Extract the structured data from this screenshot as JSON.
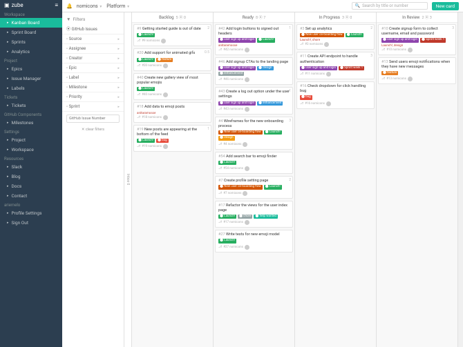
{
  "brand": "zube",
  "topbar": {
    "project": "nomicons",
    "project_suffix": "▼",
    "workspace": "Platform",
    "workspace_suffix": "▼",
    "search_placeholder": "Search by title or number",
    "new_card": "New card"
  },
  "sidebar": {
    "sections": [
      {
        "title": "Workspace",
        "items": [
          {
            "label": "Kanban Board",
            "icon": "board-icon",
            "active": true
          },
          {
            "label": "Sprint Board",
            "icon": "sprint-icon"
          },
          {
            "label": "Sprints",
            "icon": "sprints-icon"
          },
          {
            "label": "Analytics",
            "icon": "analytics-icon"
          }
        ]
      },
      {
        "title": "Project",
        "items": [
          {
            "label": "Epics",
            "icon": "epics-icon"
          },
          {
            "label": "Issue Manager",
            "icon": "issues-icon"
          },
          {
            "label": "Labels",
            "icon": "labels-icon"
          }
        ]
      },
      {
        "title": "Tickets",
        "items": [
          {
            "label": "Tickets",
            "icon": "tickets-icon"
          }
        ]
      },
      {
        "title": "GitHub Components",
        "items": [
          {
            "label": "Milestones",
            "icon": "milestones-icon"
          }
        ]
      },
      {
        "title": "Settings",
        "items": [
          {
            "label": "Project",
            "icon": "settings-project-icon"
          },
          {
            "label": "Workspace",
            "icon": "settings-workspace-icon"
          }
        ]
      },
      {
        "title": "Resources",
        "items": [
          {
            "label": "Slack",
            "icon": "slack-icon"
          },
          {
            "label": "Blog",
            "icon": "blog-icon"
          },
          {
            "label": "Docs",
            "icon": "docs-icon"
          },
          {
            "label": "Contact",
            "icon": "contact-icon"
          }
        ]
      },
      {
        "title": "ariemelo",
        "items": [
          {
            "label": "Profile Settings",
            "icon": "profile-icon"
          },
          {
            "label": "Sign Out",
            "icon": "signout-icon"
          }
        ]
      }
    ]
  },
  "filters": {
    "header": "Filters",
    "rows": [
      {
        "label": "GitHub Issues",
        "icon": "toggle"
      },
      {
        "label": "Source"
      },
      {
        "label": "Assignee"
      },
      {
        "label": "Creator"
      },
      {
        "label": "Epic"
      },
      {
        "label": "Label"
      },
      {
        "label": "Milestone"
      },
      {
        "label": "Priority"
      },
      {
        "label": "Sprint"
      }
    ],
    "input_placeholder": "GitHub Issue Number",
    "clear": "clear filters"
  },
  "inbox": {
    "label": "Inbox",
    "count": 0
  },
  "columns": [
    {
      "name": "Backlog",
      "open": 5,
      "closed": 0,
      "cards": [
        {
          "num": "#9",
          "title": "Getting started guide is out of date",
          "labels": [
            {
              "text": "Launch!",
              "color": "#27ae60"
            }
          ],
          "meta": "#9 nomicons",
          "pts": "2"
        },
        {
          "num": "#20",
          "title": "Add support for animated gifs",
          "labels": [
            {
              "text": "Launch!",
              "color": "#27ae60"
            },
            {
              "text": "feature",
              "color": "#e67e22"
            }
          ],
          "meta": "#20 nomicons",
          "pts": "0.5"
        },
        {
          "num": "#40",
          "title": "Create new gallery view of most popular emojis",
          "labels": [
            {
              "text": "Launch!",
              "color": "#27ae60"
            }
          ],
          "meta": "#40 nomicons"
        },
        {
          "num": "#18",
          "title": "Add data to emoji posts",
          "labels": [],
          "meta": "#18 nomicons",
          "sub": "anitaramosse",
          "comments": "1"
        },
        {
          "num": "#19",
          "title": "New posts are appearing at the bottom of the feed",
          "labels": [
            {
              "text": "Launch!",
              "color": "#27ae60"
            },
            {
              "text": "bug",
              "color": "#e74c3c"
            }
          ],
          "meta": "#19 nomicons",
          "pts": "1"
        }
      ]
    },
    {
      "name": "Ready",
      "open": 8,
      "closed": 7,
      "cards": [
        {
          "num": "#42",
          "title": "Add login buttons to signed out headers",
          "labels": [
            {
              "text": "user sign up and login",
              "color": "#8e44ad"
            },
            {
              "text": "Launch!",
              "color": "#27ae60"
            }
          ],
          "meta": "#42 nomicons",
          "sub": "anitaramosse",
          "pts": "1"
        },
        {
          "num": "#46",
          "title": "Add signup CTAs to the landing page",
          "labels": [
            {
              "text": "user sign up and login",
              "color": "#8e44ad"
            },
            {
              "text": "design",
              "color": "#3498db"
            },
            {
              "text": "enhancement",
              "color": "#95a5a6"
            }
          ],
          "meta": "#46 nomicons"
        },
        {
          "num": "#43",
          "title": "Create a log out option under the user settings",
          "labels": [
            {
              "text": "user sign up and login",
              "color": "#8e44ad"
            },
            {
              "text": "enhancement",
              "color": "#3498db"
            }
          ],
          "meta": "#43 nomicons",
          "pts": "1"
        },
        {
          "num": "#4",
          "title": "Wireframes for the new onboarding process",
          "labels": [
            {
              "text": "New user on-boarding flow",
              "color": "#d35400"
            },
            {
              "text": "Launch!",
              "color": "#27ae60"
            },
            {
              "text": "design",
              "color": "#f39c12"
            }
          ],
          "meta": "#4 nomicons",
          "pts": "3"
        },
        {
          "num": "#54",
          "title": "Add search bar to emoji finder",
          "labels": [
            {
              "text": "Launch!",
              "color": "#27ae60"
            }
          ],
          "meta": "#54 nomicons"
        },
        {
          "num": "#7",
          "title": "Create profile setting page",
          "labels": [
            {
              "text": "New user on-boarding flow",
              "color": "#d35400"
            },
            {
              "text": "Launch!",
              "color": "#27ae60"
            }
          ],
          "meta": "#7 nomicons",
          "pts": "2"
        },
        {
          "num": "#17",
          "title": "Refactor the views for the user index page",
          "labels": [
            {
              "text": "Launch!",
              "color": "#27ae60"
            },
            {
              "text": "chore",
              "color": "#95a5a6"
            },
            {
              "text": "help wanted",
              "color": "#1abc9c"
            }
          ],
          "meta": "#17 nomicons"
        },
        {
          "num": "#27",
          "title": "Write tests for new emoji model",
          "labels": [
            {
              "text": "Launch!",
              "color": "#27ae60"
            }
          ],
          "meta": "#27 nomicons"
        }
      ]
    },
    {
      "name": "In Progress",
      "open": 3,
      "closed": 0,
      "cards": [
        {
          "num": "#3",
          "title": "Set up analytics",
          "labels": [
            {
              "text": "New user on-boarding flow",
              "color": "#d35400"
            },
            {
              "text": "Launch!",
              "color": "#27ae60"
            }
          ],
          "sub": "Launch!, chore",
          "meta": "#3 nomicons",
          "pts": "2"
        },
        {
          "num": "#11",
          "title": "Create API endpoint to handle authentication",
          "labels": [
            {
              "text": "user sign up and login",
              "color": "#8e44ad"
            },
            {
              "text": "Sprint week 1",
              "color": "#c0392b"
            }
          ],
          "meta": "#11 nomicons",
          "pts": "3"
        },
        {
          "num": "#16",
          "title": "Check dropdown for click handling bug",
          "labels": [
            {
              "text": "bug",
              "color": "#e74c3c"
            }
          ],
          "meta": "#16 nomicons"
        }
      ]
    },
    {
      "name": "In Review",
      "open": 2,
      "closed": 3,
      "cards": [
        {
          "num": "#10",
          "title": "Create signup form to collect username, email and password",
          "labels": [
            {
              "text": "user sign up and login",
              "color": "#8e44ad"
            },
            {
              "text": "Sprint week 1",
              "color": "#c0392b"
            }
          ],
          "sub": "Launch!, design",
          "meta": "#10 nomicons",
          "pts": "3"
        },
        {
          "num": "#13",
          "title": "Send users emoji notifications when they have new messages",
          "labels": [
            {
              "text": "feature",
              "color": "#e67e22"
            }
          ],
          "meta": "#13 nomicons"
        }
      ]
    }
  ],
  "colors": {
    "sidebar": "#2c3e50",
    "accent": "#1abc9c"
  }
}
